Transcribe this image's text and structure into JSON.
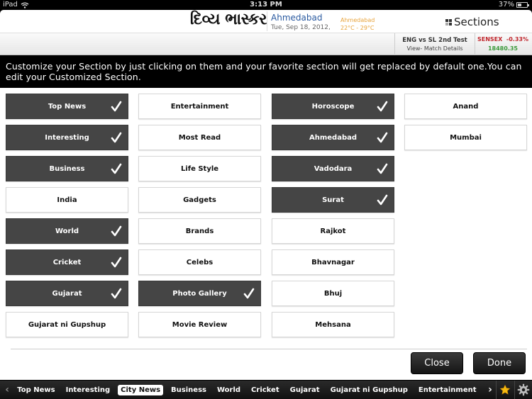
{
  "status_bar": {
    "device": "iPad",
    "time": "3:13 PM",
    "battery": "37%",
    "battery_level": 0.37
  },
  "header": {
    "logo": "દિવ્ય ભાસ્કર",
    "city": "Ahmedabad",
    "date": "Tue, Sep 18, 2012,",
    "weather_city": "Ahmedabad",
    "weather_temp": "22°C - 29°C",
    "sections_label": "Sections"
  },
  "ticker": {
    "match_title": "ENG vs SL 2nd Test",
    "match_link": "View- Match Details",
    "sensex_label": "SENSEX",
    "sensex_change": "-0.33%",
    "sensex_value": "18480.35"
  },
  "banner": {
    "text": "Customize your Section by just clicking on them and your favorite section will get replaced by default one.You can edit your Customized Section."
  },
  "sections": {
    "columns": [
      [
        {
          "label": "Top News",
          "selected": true
        },
        {
          "label": "Interesting",
          "selected": true
        },
        {
          "label": "Business",
          "selected": true
        },
        {
          "label": "India",
          "selected": false
        },
        {
          "label": "World",
          "selected": true
        },
        {
          "label": "Cricket",
          "selected": true
        },
        {
          "label": "Gujarat",
          "selected": true
        },
        {
          "label": "Gujarat ni Gupshup",
          "selected": false
        }
      ],
      [
        {
          "label": "Entertainment",
          "selected": false
        },
        {
          "label": "Most Read",
          "selected": false
        },
        {
          "label": "Life Style",
          "selected": false
        },
        {
          "label": "Gadgets",
          "selected": false
        },
        {
          "label": "Brands",
          "selected": false
        },
        {
          "label": "Celebs",
          "selected": false
        },
        {
          "label": "Photo Gallery",
          "selected": true
        },
        {
          "label": "Movie Review",
          "selected": false
        }
      ],
      [
        {
          "label": "Horoscope",
          "selected": true
        },
        {
          "label": "Ahmedabad",
          "selected": true
        },
        {
          "label": "Vadodara",
          "selected": true
        },
        {
          "label": "Surat",
          "selected": true
        },
        {
          "label": "Rajkot",
          "selected": false
        },
        {
          "label": "Bhavnagar",
          "selected": false
        },
        {
          "label": "Bhuj",
          "selected": false
        },
        {
          "label": "Mehsana",
          "selected": false
        }
      ],
      [
        {
          "label": "Anand",
          "selected": false
        },
        {
          "label": "Mumbai",
          "selected": false
        }
      ]
    ]
  },
  "actions": {
    "close_label": "Close",
    "done_label": "Done"
  },
  "bottom_nav": {
    "items": [
      {
        "label": "Top News",
        "active": false
      },
      {
        "label": "Interesting",
        "active": false
      },
      {
        "label": "City News",
        "active": true
      },
      {
        "label": "Business",
        "active": false
      },
      {
        "label": "World",
        "active": false
      },
      {
        "label": "Cricket",
        "active": false
      },
      {
        "label": "Gujarat",
        "active": false
      },
      {
        "label": "Gujarat ni Gupshup",
        "active": false
      },
      {
        "label": "Entertainment",
        "active": false
      }
    ],
    "prev_icon": "chevron-left-icon",
    "next_icon": "chevron-right-icon",
    "favorite_icon": "star-icon",
    "settings_icon": "gear-icon"
  },
  "colors": {
    "selected_tile": "#454545",
    "tile_border": "#d6d6d6",
    "city_blue": "#2a5aa0",
    "weather_orange": "#e8a33a",
    "sensex_red": "#c0272d",
    "sensex_green": "#3a9a3a",
    "star_yellow": "#f5b90f"
  }
}
